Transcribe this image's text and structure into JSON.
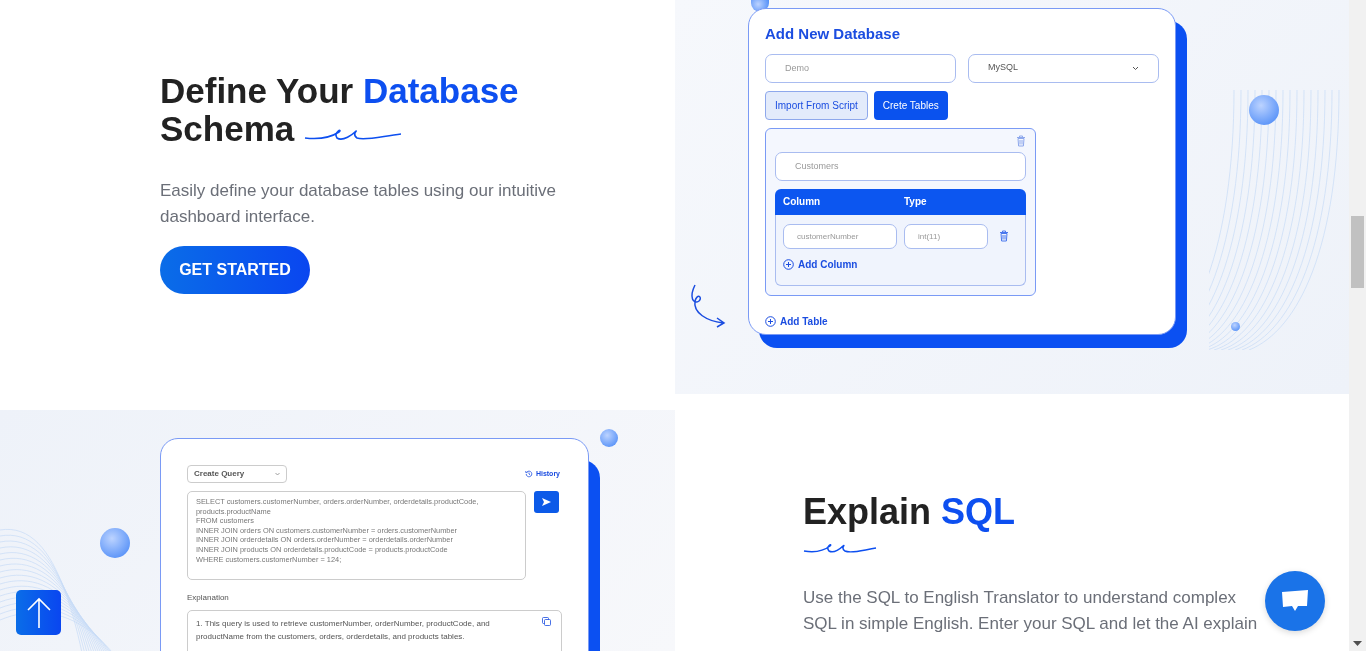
{
  "schema_section": {
    "title_lines": [
      {
        "parts": [
          {
            "text": "Define Your",
            "highlight": false
          },
          {
            "text": "Database",
            "highlight": true
          }
        ]
      },
      {
        "parts": [
          {
            "text": "Schema",
            "highlight": false
          }
        ]
      }
    ],
    "description": "Easily define your database tables using our intuitive dashboard interface.",
    "button": "GET STARTED"
  },
  "database_form": {
    "title": "Add New Database",
    "name_placeholder": "Demo",
    "engine": "MySQL",
    "buttons": [
      {
        "label": "Import From Script",
        "kind": "outline"
      },
      {
        "label": "Crete Tables",
        "kind": "solid"
      }
    ],
    "table": {
      "name_placeholder": "Customers",
      "headers": [
        "Column",
        "Type"
      ],
      "rows": [
        {
          "column_placeholder": "customerNumber",
          "type_placeholder": "int(11)"
        }
      ],
      "add_column": "Add Column"
    },
    "add_table": "Add Table"
  },
  "query_panel": {
    "mode": "Create Query",
    "history": "History",
    "query_lines": [
      "SELECT customers.customerNumber, orders.orderNumber, orderdetails.productCode, products.productName",
      "FROM customers",
      "INNER JOIN orders ON customers.customerNumber = orders.customerNumber",
      "INNER JOIN orderdetails ON orders.orderNumber = orderdetails.orderNumber",
      "INNER JOIN products ON orderdetails.productCode = products.productCode",
      "WHERE customers.customerNumber = 124;"
    ],
    "explanation_label": "Explanation",
    "explanation": "1. This query is used to retrieve customerNumber, orderNumber, productCode, and productName from the customers, orders, orderdetails, and products tables."
  },
  "sql_section": {
    "title_lines": [
      {
        "parts": [
          {
            "text": "Explain",
            "highlight": false
          },
          {
            "text": "SQL",
            "highlight": true
          }
        ]
      }
    ],
    "description": "Use the SQL to English Translator to understand complex SQL in simple English. Enter your SQL and let the AI explain"
  }
}
